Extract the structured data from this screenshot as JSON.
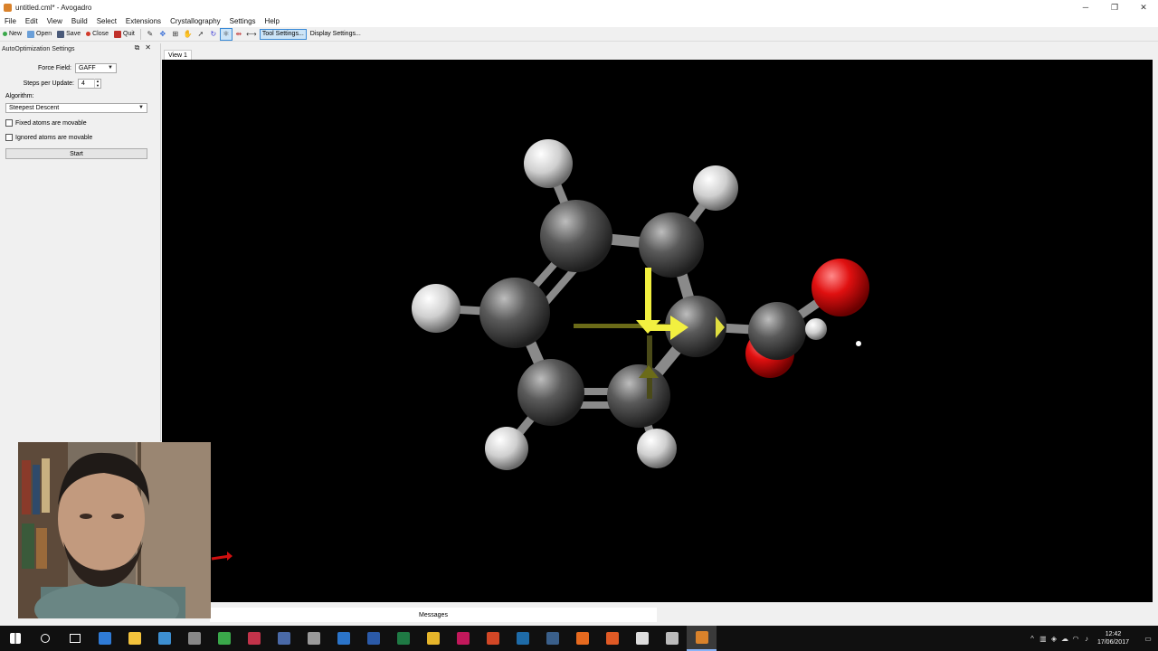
{
  "window": {
    "title": "untitled.cml* - Avogadro",
    "minimize_glyph": "─",
    "maximize_glyph": "❐",
    "close_glyph": "✕"
  },
  "menu": [
    "File",
    "Edit",
    "View",
    "Build",
    "Select",
    "Extensions",
    "Crystallography",
    "Settings",
    "Help"
  ],
  "toolbar": {
    "new_label": "New",
    "open_label": "Open",
    "save_label": "Save",
    "close_label": "Close",
    "quit_label": "Quit",
    "tool_settings_label": "Tool Settings...",
    "display_settings_label": "Display Settings...",
    "tools": [
      {
        "name": "draw-tool-icon",
        "glyph": "✎"
      },
      {
        "name": "navigate-tool-icon",
        "glyph": "✥"
      },
      {
        "name": "bond-centric-tool-icon",
        "glyph": "⊞"
      },
      {
        "name": "manipulate-tool-icon",
        "glyph": "✋"
      },
      {
        "name": "select-tool-icon",
        "glyph": "➚"
      },
      {
        "name": "autorotate-tool-icon",
        "glyph": "↻"
      },
      {
        "name": "autooptimization-tool-icon",
        "glyph": "⚛"
      },
      {
        "name": "align-tool-icon",
        "glyph": "⇹"
      },
      {
        "name": "measure-tool-icon",
        "glyph": "⟷"
      }
    ]
  },
  "dock": {
    "title": "AutoOptimization Settings",
    "float_glyph": "⧉",
    "close_glyph": "✕",
    "force_field_label": "Force Field:",
    "force_field_value": "GAFF",
    "steps_label": "Steps per Update:",
    "steps_value": "4",
    "algorithm_label": "Algorithm:",
    "algorithm_value": "Steepest Descent",
    "fixed_atoms_label": "Fixed atoms are movable",
    "ignored_atoms_label": "Ignored atoms are movable",
    "start_label": "Start"
  },
  "view_tab_label": "View 1",
  "messages_label": "Messages",
  "taskbar": {
    "apps": [
      {
        "name": "start-icon",
        "color": "#ffffff"
      },
      {
        "name": "search-icon",
        "color": "#ffffff"
      },
      {
        "name": "task-view-icon",
        "color": "#ffffff"
      },
      {
        "name": "edge-icon",
        "color": "#2f7bd6"
      },
      {
        "name": "file-explorer-icon",
        "color": "#f3c33c"
      },
      {
        "name": "app-blue-icon",
        "color": "#3d8fd1"
      },
      {
        "name": "app-tools-icon",
        "color": "#888888"
      },
      {
        "name": "app-m-icon",
        "color": "#3aa84a"
      },
      {
        "name": "app-red-icon",
        "color": "#c2334a"
      },
      {
        "name": "app-dark-icon",
        "color": "#4a6aa8"
      },
      {
        "name": "app-gray-icon",
        "color": "#9a9a9a"
      },
      {
        "name": "app-window-icon",
        "color": "#2b74c9"
      },
      {
        "name": "word-icon",
        "color": "#2b5aa8"
      },
      {
        "name": "excel-icon",
        "color": "#1f7a44"
      },
      {
        "name": "chrome-icon",
        "color": "#e6b52a"
      },
      {
        "name": "app-pink-icon",
        "color": "#c2185b"
      },
      {
        "name": "powerpoint-icon",
        "color": "#d24726"
      },
      {
        "name": "app-monitor-icon",
        "color": "#1e6ba8"
      },
      {
        "name": "steam-icon",
        "color": "#3a5f8a"
      },
      {
        "name": "firefox-icon",
        "color": "#e66a1f"
      },
      {
        "name": "ubuntu-icon",
        "color": "#e05a25"
      },
      {
        "name": "mail-icon",
        "color": "#dddddd"
      },
      {
        "name": "app-flag-icon",
        "color": "#bbbbbb"
      },
      {
        "name": "avogadro-icon",
        "color": "#d9822b"
      }
    ],
    "time": "12:42",
    "date": "17/06/2017"
  }
}
